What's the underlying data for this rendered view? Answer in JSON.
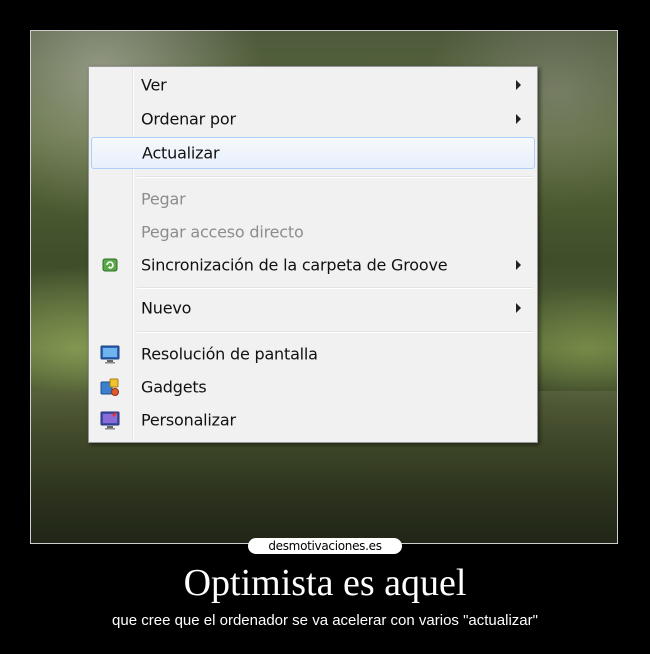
{
  "context_menu": {
    "items": [
      {
        "label": "Ver",
        "has_submenu": true,
        "enabled": true
      },
      {
        "label": "Ordenar por",
        "has_submenu": true,
        "enabled": true
      },
      {
        "label": "Actualizar",
        "has_submenu": false,
        "enabled": true,
        "highlighted": true
      },
      {
        "label": "Pegar",
        "has_submenu": false,
        "enabled": false
      },
      {
        "label": "Pegar acceso directo",
        "has_submenu": false,
        "enabled": false
      },
      {
        "label": "Sincronización de la carpeta de Groove",
        "has_submenu": true,
        "enabled": true,
        "icon": "groove-sync-icon"
      },
      {
        "label": "Nuevo",
        "has_submenu": true,
        "enabled": true
      },
      {
        "label": "Resolución de pantalla",
        "has_submenu": false,
        "enabled": true,
        "icon": "display-resolution-icon"
      },
      {
        "label": "Gadgets",
        "has_submenu": false,
        "enabled": true,
        "icon": "gadgets-icon"
      },
      {
        "label": "Personalizar",
        "has_submenu": false,
        "enabled": true,
        "icon": "personalize-icon"
      }
    ],
    "colors": {
      "background": "#f1f1f1",
      "highlight_border": "#aecff7",
      "disabled_text": "#8d8d8d"
    }
  },
  "poster": {
    "site_badge": "desmotivaciones.es",
    "title": "Optimista es aquel",
    "subtitle": "que cree que el ordenador se va acelerar con varios \"actualizar\""
  }
}
